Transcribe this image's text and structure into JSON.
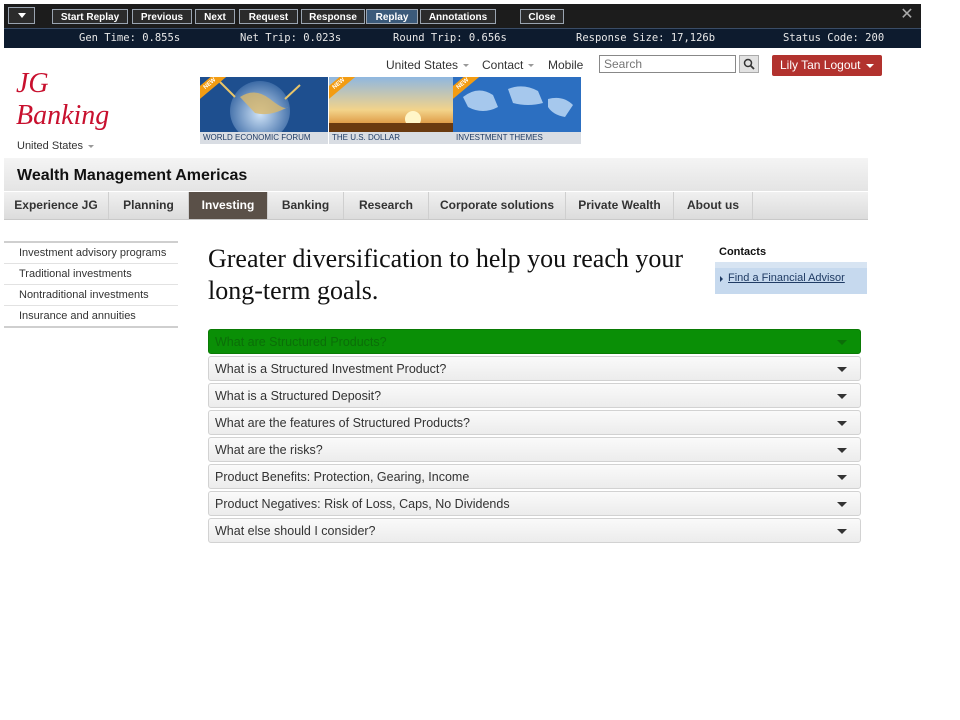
{
  "replay_toolbar": {
    "buttons": [
      "Start Replay",
      "Previous",
      "Next",
      "Request",
      "Response",
      "Replay",
      "Annotations",
      "Close"
    ],
    "active": "Replay",
    "stats": [
      "Gen Time: 0.855s",
      "Net Trip: 0.023s",
      "Round Trip: 0.656s",
      "Response Size: 17,126b",
      "Status Code: 200"
    ]
  },
  "brand": {
    "line1": "JG",
    "line2": "Banking",
    "color": "#c8102e"
  },
  "country": "United States",
  "banners": [
    {
      "caption": "WORLD ECONOMIC FORUM",
      "tag": "NEW"
    },
    {
      "caption": "THE U.S. DOLLAR",
      "tag": "NEW"
    },
    {
      "caption": "INVESTMENT THEMES",
      "tag": "NEW"
    }
  ],
  "utility_nav": {
    "region": "United States",
    "contact": "Contact",
    "mobile": "Mobile",
    "search_placeholder": "Search",
    "logout": "Lily Tan Logout"
  },
  "section_title": "Wealth Management Americas",
  "main_nav": {
    "items": [
      "Experience JG",
      "Planning",
      "Investing",
      "Banking",
      "Research",
      "Corporate solutions",
      "Private Wealth",
      "About us"
    ],
    "active": "Investing",
    "active_color": "#5a5048"
  },
  "left_nav": [
    "Investment advisory programs",
    "Traditional investments",
    "Nontraditional investments",
    "Insurance and annuities"
  ],
  "headline": "Greater diversification to help you reach your long-term goals.",
  "contacts": {
    "title": "Contacts",
    "link": "Find a Financial Advisor"
  },
  "accordion": {
    "active_color": "#0a8f06",
    "items": [
      "What are Structured Products?",
      "What is a Structured Investment Product?",
      "What is a Structured Deposit?",
      "What are the features of Structured Products?",
      "What are the risks?",
      "Product Benefits: Protection, Gearing, Income",
      "Product Negatives: Risk of Loss, Caps, No Dividends",
      "What else should I consider?"
    ]
  }
}
